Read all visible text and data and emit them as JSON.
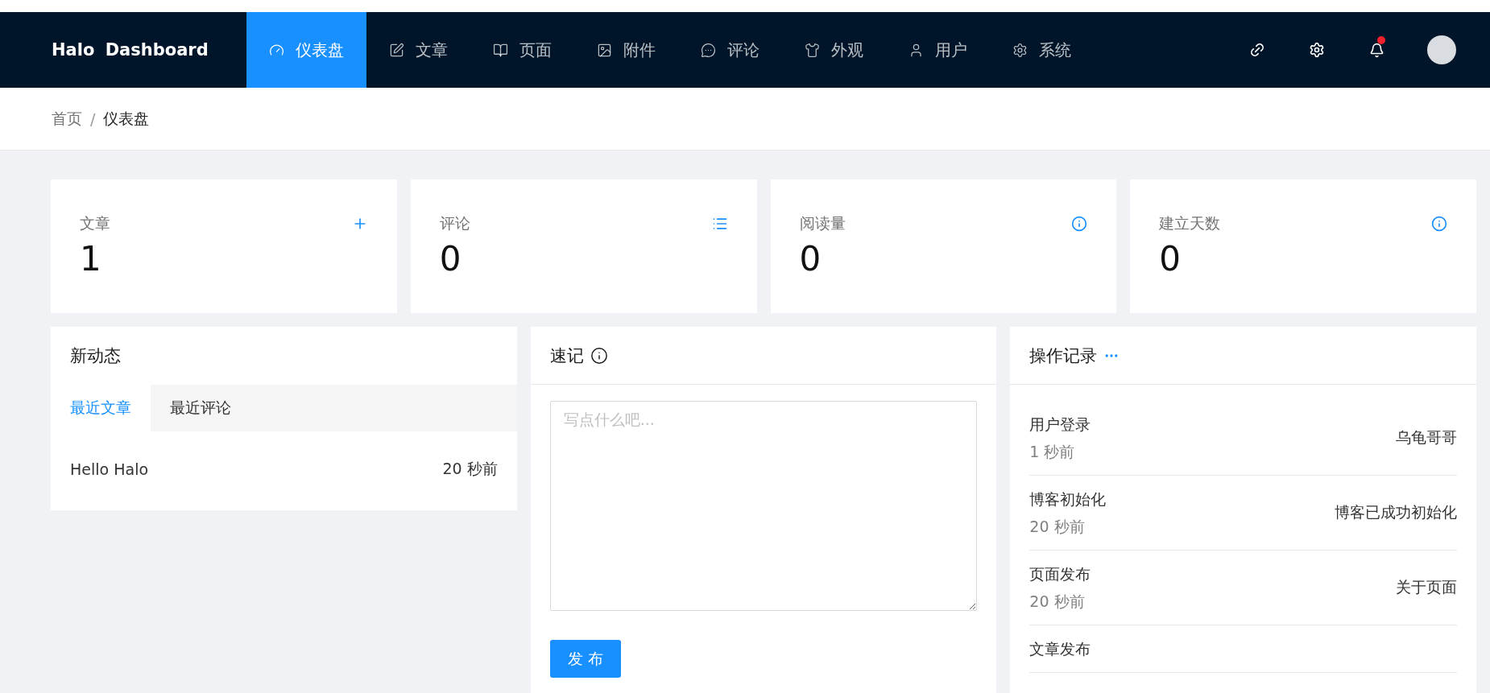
{
  "header": {
    "brand": "Halo Dashboard",
    "nav": [
      {
        "label": "仪表盘",
        "selected": true
      },
      {
        "label": "文章",
        "selected": false
      },
      {
        "label": "页面",
        "selected": false
      },
      {
        "label": "附件",
        "selected": false
      },
      {
        "label": "评论",
        "selected": false
      },
      {
        "label": "外观",
        "selected": false
      },
      {
        "label": "用户",
        "selected": false
      },
      {
        "label": "系统",
        "selected": false
      }
    ],
    "notifications_unread": true
  },
  "breadcrumb": {
    "items": [
      "首页",
      "仪表盘"
    ],
    "separator": "/"
  },
  "stats": [
    {
      "label": "文章",
      "value": "1",
      "kind": "add"
    },
    {
      "label": "评论",
      "value": "0",
      "kind": "list"
    },
    {
      "label": "阅读量",
      "value": "0",
      "kind": "info"
    },
    {
      "label": "建立天数",
      "value": "0",
      "kind": "info"
    }
  ],
  "recent": {
    "title": "新动态",
    "tabs": [
      {
        "label": "最近文章",
        "selected": true
      },
      {
        "label": "最近评论",
        "selected": false
      }
    ],
    "items": [
      {
        "title": "Hello Halo",
        "time": "20 秒前"
      }
    ]
  },
  "memo": {
    "title": "速记",
    "placeholder": "写点什么吧...",
    "button": "发 布"
  },
  "log": {
    "title": "操作记录",
    "entries": [
      {
        "type": "用户登录",
        "time": "1 秒前",
        "content": "乌龟哥哥"
      },
      {
        "type": "博客初始化",
        "time": "20 秒前",
        "content": "博客已成功初始化"
      },
      {
        "type": "页面发布",
        "time": "20 秒前",
        "content": "关于页面"
      },
      {
        "type": "文章发布"
      }
    ]
  }
}
